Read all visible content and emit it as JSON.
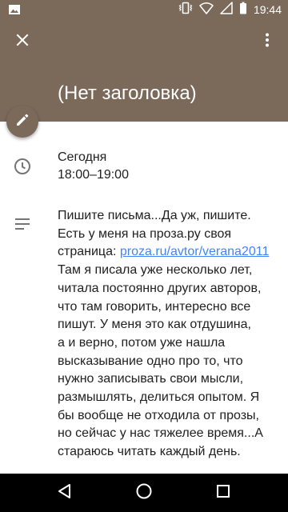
{
  "status_bar": {
    "time": "19:44",
    "left_icon": "image-icon",
    "right_icons": [
      "vibrate-icon",
      "wifi-icon",
      "signal-icon",
      "battery-icon"
    ]
  },
  "header": {
    "title": "(Нет заголовка)",
    "close_icon": "close-icon",
    "more_icon": "more-vert-icon",
    "background_color": "#7b6a5a"
  },
  "event": {
    "date": "Сегодня",
    "time_range": "18:00–19:00",
    "description_before_link": "Пишите письма...Да уж, пишите.\nЕсть у меня на проза.ру своя\nстраница: ",
    "link_text": "proza.ru/avtor/verana2011",
    "description_after_link": "\nТам я писала уже несколько лет,\nчитала постоянно других авторов,\nчто там говорить, интересно все\nпишут. У меня это как отдушина,\nа и верно, потом уже нашла\nвысказывание одно про то, что\nнужно записывать свои мысли,\nразмышлять, делиться опытом. Я\nбы вообще не отходила от прозы,\nно сейчас у нас тяжелее время...А\nстараюсь читать каждый день."
  },
  "colors": {
    "accent": "#7b6a5a",
    "link": "#4285f4",
    "text": "#212121",
    "icon": "#757575"
  },
  "nav_bar": {
    "icons": [
      "back-icon",
      "home-icon",
      "recents-icon"
    ]
  }
}
